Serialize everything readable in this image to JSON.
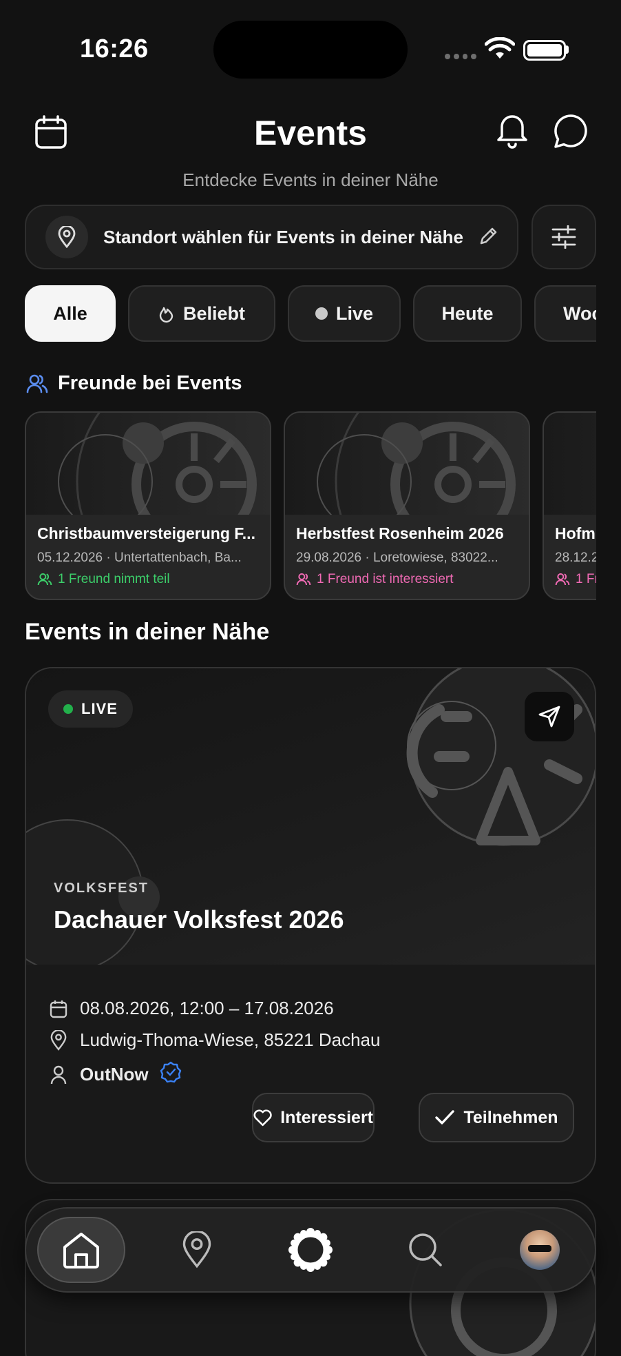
{
  "status_bar": {
    "time": "16:26"
  },
  "header": {
    "title": "Events",
    "subtitle": "Entdecke Events in deiner Nähe",
    "icons": [
      "calendar-icon",
      "bell-icon",
      "chat-bubble-icon"
    ]
  },
  "location": {
    "text": "Standort wählen für Events in deiner Nähe",
    "icons": [
      "map-pin-icon",
      "pencil-icon",
      "sliders-icon"
    ]
  },
  "filters": [
    {
      "label": "Alle",
      "active": true
    },
    {
      "label": "Beliebt",
      "icon": "flame-icon"
    },
    {
      "label": "Live",
      "icon": "dot-icon"
    },
    {
      "label": "Heute"
    },
    {
      "label": "Woc"
    }
  ],
  "friends_section": {
    "title": "Freunde bei Events",
    "cards": [
      {
        "title": "Christbaumversteigerung F...",
        "meta": "05.12.2026 · Untertattenbach, Ba...",
        "status": "1 Freund nimmt teil",
        "status_color": "#3ccf6a"
      },
      {
        "title": "Herbstfest Rosenheim 2026",
        "meta": "29.08.2026 · Loretowiese, 83022...",
        "status": "1 Freund ist interessiert",
        "status_color": "#f06ab4"
      },
      {
        "title": "Hofm",
        "meta": "28.12.2",
        "status": "1 Fr",
        "status_color": "#f06ab4"
      }
    ]
  },
  "nearby_section": {
    "title": "Events in deiner Nähe",
    "event": {
      "badge": "LIVE",
      "category": "VOLKSFEST",
      "name": "Dachauer Volksfest 2026",
      "date": "08.08.2026, 12:00 – 17.08.2026",
      "location": "Ludwig-Thoma-Wiese, 85221 Dachau",
      "organizer": "OutNow",
      "interested_label": "Interessiert",
      "attend_label": "Teilnehmen"
    }
  },
  "tabbar": {
    "items": [
      "home-icon",
      "map-pin-icon",
      "flower-icon",
      "search-icon",
      "avatar"
    ],
    "active": "home-icon"
  },
  "colors": {
    "background": "#121212",
    "card": "#191919",
    "live": "#22b04b",
    "verified": "#3b82f6"
  }
}
